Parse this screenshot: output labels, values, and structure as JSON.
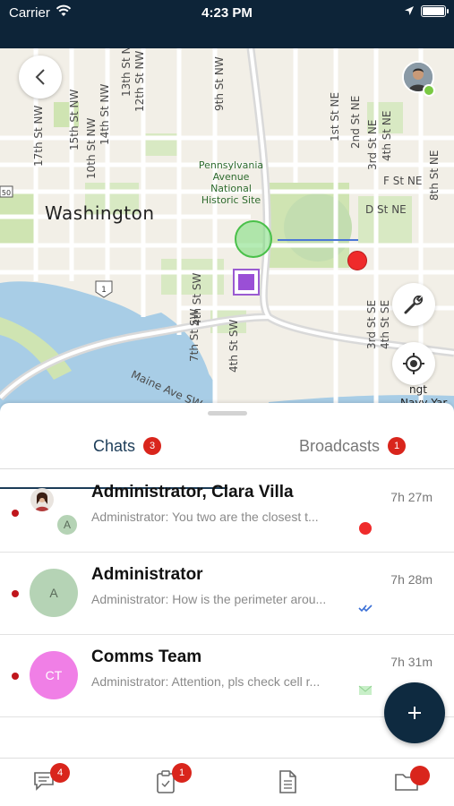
{
  "status_bar": {
    "carrier": "Carrier",
    "time": "4:23 PM"
  },
  "map": {
    "city_label": "Washington",
    "poi_label": "Pennsylvania Avenue National Historic Site",
    "street_labels": [
      "13th St NW",
      "12th St NW",
      "14th St NW",
      "15th St NW",
      "17th St NW",
      "10th St NW",
      "9th St NW",
      "7th St SW",
      "4th St SW",
      "4th St SW",
      "Maine Ave SW",
      "1st St NE",
      "2nd St NE",
      "3rd St NE",
      "4th St NE",
      "8th St NE",
      "F St NE",
      "D St NE",
      "3rd St SE",
      "4th St SE"
    ],
    "navy_label": "Navy Yar",
    "navy_label_top": "ngt",
    "shield_1": "1",
    "shield_50": "50",
    "colors": {
      "water": "#a8cde6",
      "park": "#cfe4b2",
      "road": "#ffffff",
      "green_marker": "#4ac04a",
      "red_marker": "#ef2b2b",
      "purple_marker": "#9a4fd6"
    }
  },
  "tabs": {
    "chats": {
      "label": "Chats",
      "badge": "3"
    },
    "broadcasts": {
      "label": "Broadcasts",
      "badge": "1"
    }
  },
  "chats": [
    {
      "name": "Administrator, Clara Villa",
      "preview": "Administrator: You two are the closest t...",
      "time": "7h 27m",
      "avatar_initial": "A",
      "status_icon": "red-dot-icon"
    },
    {
      "name": "Administrator",
      "preview": "Administrator: How is the perimeter arou...",
      "time": "7h 28m",
      "avatar_initial": "A",
      "status_icon": "double-check-icon"
    },
    {
      "name": "Comms Team",
      "preview": "Administrator: Attention, pls check cell r...",
      "time": "7h 31m",
      "avatar_initial": "CT",
      "status_icon": "mail-icon"
    }
  ],
  "bottom_nav": {
    "chat_badge": "4",
    "tasks_badge": "1"
  },
  "colors": {
    "brand": "#0d2438",
    "badge": "#d9251c",
    "accent": "#1c3c58"
  }
}
